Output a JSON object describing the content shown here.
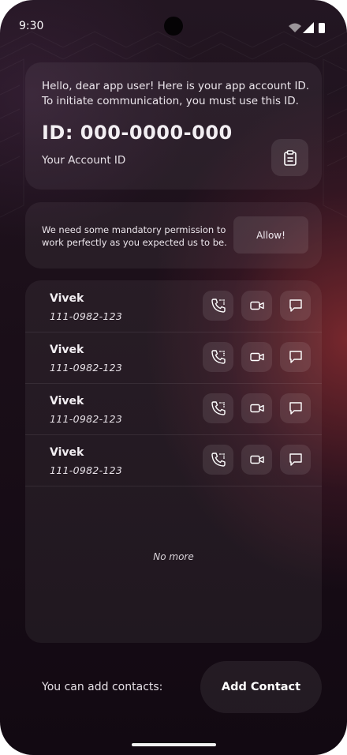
{
  "status_bar": {
    "time": "9:30"
  },
  "account": {
    "intro": "Hello, dear app user! Here is your app account ID. To initiate communication, you must use this ID.",
    "id_text": "ID: 000-0000-000",
    "id_label": "Your Account ID",
    "copy_icon": "clipboard-icon"
  },
  "permission": {
    "message": "We need some mandatory permission to work perfectly as you expected us to be.",
    "allow_label": "Allow!"
  },
  "contacts": [
    {
      "name": "Vivek",
      "phone": "111-0982-123"
    },
    {
      "name": "Vivek",
      "phone": "111-0982-123"
    },
    {
      "name": "Vivek",
      "phone": "111-0982-123"
    },
    {
      "name": "Vivek",
      "phone": "111-0982-123"
    }
  ],
  "actions": {
    "call_icon": "phone-call-icon",
    "video_icon": "video-icon",
    "message_icon": "message-icon"
  },
  "list_end_text": "No more",
  "footer": {
    "prompt": "You can add contacts:",
    "add_label": "Add Contact"
  },
  "colors": {
    "accent_glow": "#963034",
    "background": "#1b0f19"
  }
}
